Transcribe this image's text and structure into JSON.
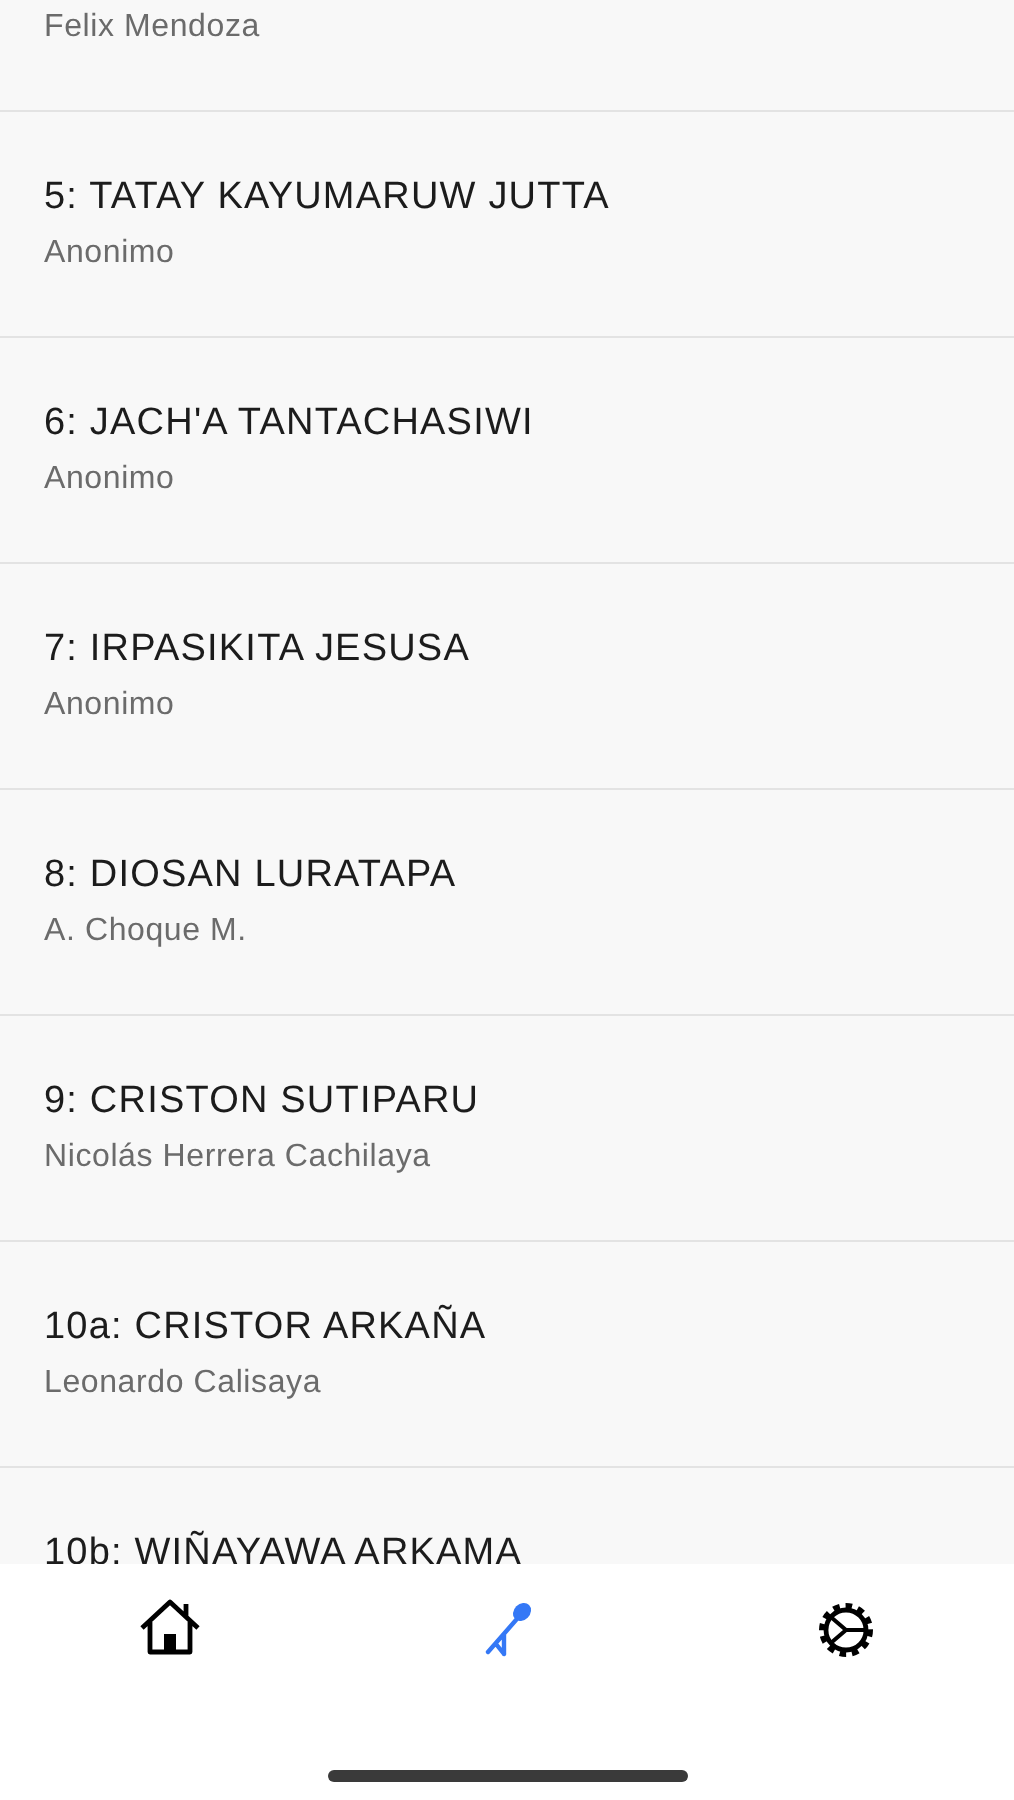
{
  "songs": [
    {
      "subtitle": "Felix Mendoza"
    },
    {
      "title": "5: TATAY KAYUMARUW JUTTA",
      "subtitle": "Anonimo"
    },
    {
      "title": "6: JACH'A TANTACHASIWI",
      "subtitle": "Anonimo"
    },
    {
      "title": "7: IRPASIKITA JESUSA",
      "subtitle": "Anonimo"
    },
    {
      "title": "8: DIOSAN LURATAPA",
      "subtitle": "A. Choque M."
    },
    {
      "title": "9: CRISTON SUTIPARU",
      "subtitle": "Nicolás Herrera Cachilaya"
    },
    {
      "title": "10a: CRISTOR ARKAÑA",
      "subtitle": "Leonardo Calisaya"
    },
    {
      "title": "10b: WIÑAYAWA ARKAMA"
    }
  ],
  "tab_bar": [
    {
      "kind": "home",
      "selected": false
    },
    {
      "kind": "microphone",
      "selected": true
    },
    {
      "kind": "settings",
      "selected": false
    }
  ]
}
